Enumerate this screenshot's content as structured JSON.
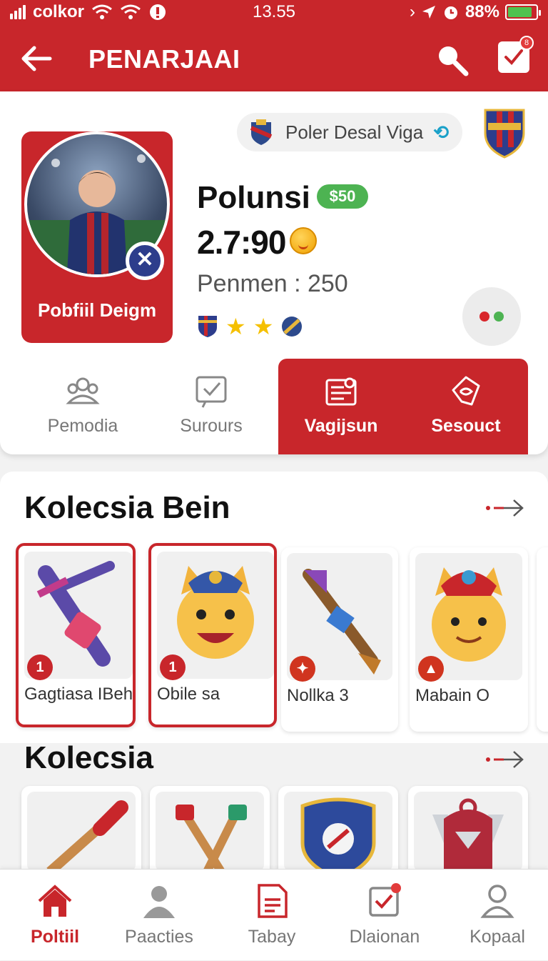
{
  "status_bar": {
    "carrier": "colkor",
    "time": "13.55",
    "battery": "88%",
    "battery_level": 0.88
  },
  "header": {
    "title": "PENARJAAI",
    "notification_count": "8"
  },
  "profile": {
    "league": "Poler Desal Viga",
    "avatar_label": "Pobfiil Deigm",
    "name": "Polunsi",
    "badge": "$50",
    "score": "2.7:90",
    "power": "Penmen : 250",
    "tabs": [
      {
        "label": "Pemodia",
        "active": false
      },
      {
        "label": "Surours",
        "active": false
      },
      {
        "label": "Vagijsun",
        "active": true
      },
      {
        "label": "Sesouct",
        "active": true
      }
    ]
  },
  "section1": {
    "title": "Kolecsia Bein",
    "items": [
      {
        "name": "Gagtiasa IBeh",
        "count": "1",
        "selected": true
      },
      {
        "name": "Obile sa",
        "count": "1",
        "selected": true
      },
      {
        "name": "Nollka 3",
        "count": "",
        "selected": false
      },
      {
        "name": "Mabain O",
        "count": "",
        "selected": false
      }
    ]
  },
  "section2": {
    "title": "Kolecsia"
  },
  "nav": {
    "items": [
      {
        "label": "Poltiil",
        "active": true
      },
      {
        "label": "Paacties",
        "active": false
      },
      {
        "label": "Tabay",
        "active": false
      },
      {
        "label": "Dlaionan",
        "active": false
      },
      {
        "label": "Kopaal",
        "active": false
      }
    ]
  },
  "colors": {
    "brand": "#c8262b",
    "badge_green": "#4db352"
  }
}
